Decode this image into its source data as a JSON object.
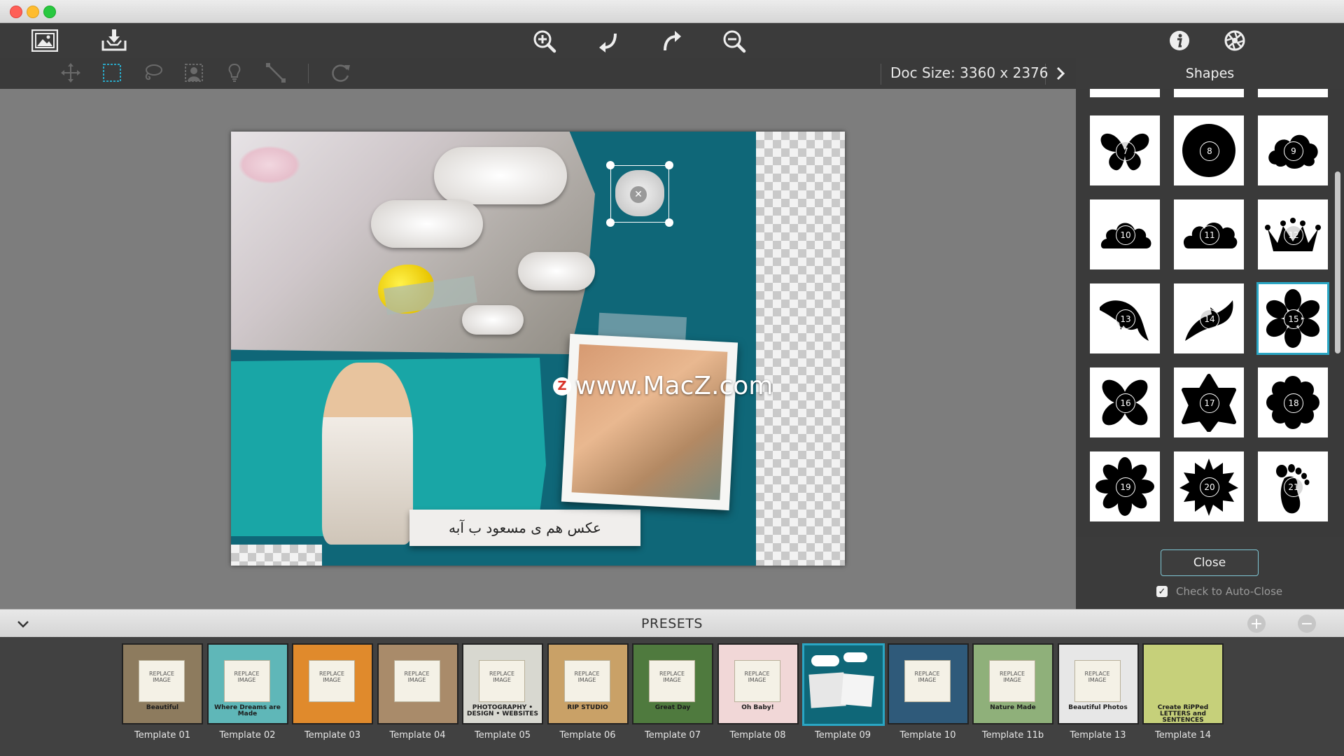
{
  "toolbar": {
    "icons": [
      "image-open-icon",
      "save-tray-icon",
      "zoom-in-icon",
      "undo-icon",
      "redo-icon",
      "zoom-out-icon",
      "info-icon",
      "settings-aperture-icon"
    ]
  },
  "tools": [
    "move-tool-icon",
    "rect-select-tool-icon",
    "lasso-tool-icon",
    "person-select-tool-icon",
    "brush-bulb-tool-icon",
    "line-tool-icon",
    "rotate-tool-icon"
  ],
  "doc_size": "Doc Size: 3360 x 2376",
  "canvas": {
    "watermark": "www.MacZ.com",
    "caption": "عکس هم ی مسعود ب آبه",
    "colors": {
      "teal_dark": "#0f6778",
      "teal_light": "#19a6a6"
    }
  },
  "shapes_panel": {
    "title": "Shapes",
    "tiles": [
      {
        "num": "7",
        "shape": "butterfly"
      },
      {
        "num": "8",
        "shape": "circle"
      },
      {
        "num": "9",
        "shape": "cloud"
      },
      {
        "num": "10",
        "shape": "cloud-flat"
      },
      {
        "num": "11",
        "shape": "cloud-wide"
      },
      {
        "num": "12",
        "shape": "crown"
      },
      {
        "num": "13",
        "shape": "dolphin"
      },
      {
        "num": "14",
        "shape": "dolphin-jump"
      },
      {
        "num": "15",
        "shape": "flower-6"
      },
      {
        "num": "16",
        "shape": "flower-4"
      },
      {
        "num": "17",
        "shape": "flower-pointed"
      },
      {
        "num": "18",
        "shape": "flower-round"
      },
      {
        "num": "19",
        "shape": "flower-8"
      },
      {
        "num": "20",
        "shape": "flower-burst"
      },
      {
        "num": "21",
        "shape": "foot"
      }
    ],
    "selected": "15",
    "close_label": "Close",
    "autoclose_label": "Check to Auto-Close",
    "autoclose_checked": true,
    "accent": "#2aa6c4"
  },
  "presets": {
    "title": "PRESETS",
    "selected": "Template 09",
    "items": [
      {
        "label": "Template 01",
        "bg": "#8d7b5e",
        "card": "REPLACE IMAGE",
        "word": "Beautiful"
      },
      {
        "label": "Template 02",
        "bg": "#5fb7b8",
        "card": "REPLACE IMAGE",
        "word": "Where Dreams are Made"
      },
      {
        "label": "Template 03",
        "bg": "#e08a2c",
        "card": "REPLACE IMAGE",
        "word": ""
      },
      {
        "label": "Template 04",
        "bg": "#a98b6a",
        "card": "REPLACE IMAGE",
        "word": ""
      },
      {
        "label": "Template 05",
        "bg": "#d8d8d0",
        "card": "REPLACE IMAGE",
        "word": "PHOTOGRAPHY • DESIGN • WEBSITES"
      },
      {
        "label": "Template 06",
        "bg": "#c9a167",
        "card": "REPLACE IMAGE",
        "word": "RIP STUDIO"
      },
      {
        "label": "Template 07",
        "bg": "#4f7a3e",
        "card": "REPLACE IMAGE",
        "word": "Great Day"
      },
      {
        "label": "Template 08",
        "bg": "#f1d7d7",
        "card": "REPLACE IMAGE",
        "word": "Oh Baby!"
      },
      {
        "label": "Template 09",
        "bg": "#0f6778",
        "card": "",
        "word": ""
      },
      {
        "label": "Template 10",
        "bg": "#2f5a7a",
        "card": "REPLACE IMAGE",
        "word": ""
      },
      {
        "label": "Template 11b",
        "bg": "#8fb07a",
        "card": "REPLACE IMAGE",
        "word": "Nature Made"
      },
      {
        "label": "Template 13",
        "bg": "#e7e7e7",
        "card": "REPLACE IMAGE",
        "word": "Beautiful Photos"
      },
      {
        "label": "Template 14",
        "bg": "#c6d07a",
        "card": "",
        "word": "Create RiPPed LETTERS and SENTENCES"
      }
    ]
  }
}
